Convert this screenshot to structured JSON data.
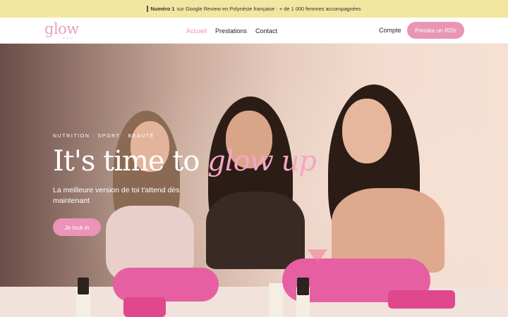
{
  "announcement": {
    "bold": "Numéro 1",
    "text": "sur Google Review en Polynésie française · + de 1 000 femmes accompagnées"
  },
  "nav": {
    "logo": "glow",
    "logo_sub": "nutrition",
    "links": [
      "Accueil",
      "Prestations",
      "Contact"
    ],
    "account": "Compte",
    "cta": "Prendre un RDV"
  },
  "hero": {
    "tagline": "NUTRITION · SPORT · BEAUTÉ",
    "headline_plain": "It's time to ",
    "headline_accent": "glow up",
    "subtitle": "La meilleure version de toi t'attend dès maintenant",
    "cta": "Je lock in"
  },
  "colors": {
    "accent": "#e995b4",
    "announcement_bg": "#f3e6a0"
  }
}
